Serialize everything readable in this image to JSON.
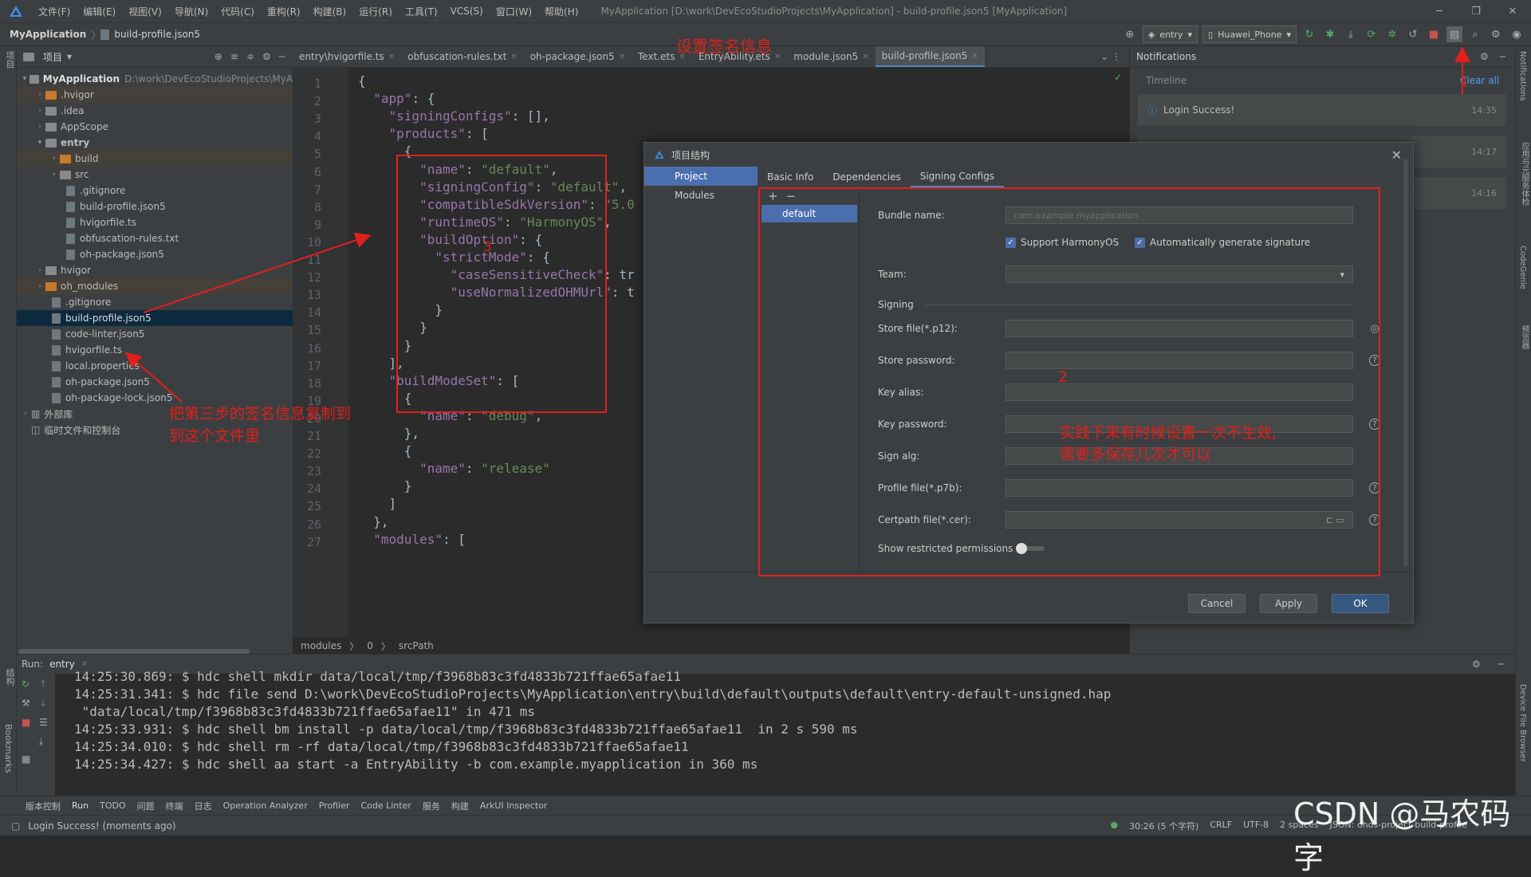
{
  "menubar": {
    "items": [
      "文件(F)",
      "编辑(E)",
      "视图(V)",
      "导航(N)",
      "代码(C)",
      "重构(R)",
      "构建(B)",
      "运行(R)",
      "工具(T)",
      "VCS(S)",
      "窗口(W)",
      "帮助(H)"
    ],
    "window_title": "MyApplication [D:\\work\\DevEcoStudioProjects\\MyApplication] - build-profile.json5 [MyApplication]"
  },
  "navbar": {
    "crumbs": [
      "MyApplication",
      "build-profile.json5"
    ],
    "run_config": "entry",
    "device": "Huawei_Phone"
  },
  "left_stripe": {
    "project_label": "项目",
    "bookmarks_label": "Bookmarks",
    "structure_label": "结构"
  },
  "project": {
    "title": "项目",
    "rows": [
      {
        "name": "MyApplication",
        "path": "D:\\work\\DevEcoStudioProjects\\MyA"
      },
      {
        "name": ".hvigor"
      },
      {
        "name": ".idea"
      },
      {
        "name": "AppScope"
      },
      {
        "name": "entry"
      },
      {
        "name": "build"
      },
      {
        "name": "src"
      },
      {
        "name": ".gitignore"
      },
      {
        "name": "build-profile.json5"
      },
      {
        "name": "hvigorfile.ts"
      },
      {
        "name": "obfuscation-rules.txt"
      },
      {
        "name": "oh-package.json5"
      },
      {
        "name": "hvigor"
      },
      {
        "name": "oh_modules"
      },
      {
        "name": ".gitignore"
      },
      {
        "name": "build-profile.json5"
      },
      {
        "name": "code-linter.json5"
      },
      {
        "name": "hvigorfile.ts"
      },
      {
        "name": "local.properties"
      },
      {
        "name": "oh-package.json5"
      },
      {
        "name": "oh-package-lock.json5"
      },
      {
        "name": "外部库"
      },
      {
        "name": "临时文件和控制台"
      }
    ]
  },
  "editor": {
    "tabs": [
      "entry\\hvigorfile.ts",
      "obfuscation-rules.txt",
      "oh-package.json5",
      "Text.ets",
      "EntryAbility.ets",
      "module.json5",
      "build-profile.json5"
    ],
    "line_numbers": [
      "1",
      "2",
      "3",
      "4",
      "5",
      "6",
      "7",
      "8",
      "9",
      "10",
      "11",
      "12",
      "13",
      "14",
      "15",
      "16",
      "17",
      "18",
      "19",
      "20",
      "21",
      "22",
      "23",
      "24",
      "25",
      "26",
      "27"
    ],
    "lines": [
      {
        "i": "",
        "k": "",
        "v": "{"
      },
      {
        "i": "  ",
        "k": "\"app\"",
        "v": ": {"
      },
      {
        "i": "    ",
        "k": "\"signingConfigs\"",
        "v": ": [],"
      },
      {
        "i": "    ",
        "k": "\"products\"",
        "v": ": ["
      },
      {
        "i": "      ",
        "k": "",
        "v": "{"
      },
      {
        "i": "        ",
        "k": "\"name\"",
        "v": ": ",
        "s": "\"default\"",
        "t": ","
      },
      {
        "i": "        ",
        "k": "\"signingConfig\"",
        "v": ": ",
        "s": "\"default\"",
        "t": ","
      },
      {
        "i": "        ",
        "k": "\"compatibleSdkVersion\"",
        "v": ": ",
        "s": "\"5.0",
        "t": ""
      },
      {
        "i": "        ",
        "k": "\"runtimeOS\"",
        "v": ": ",
        "s": "\"HarmonyOS\"",
        "t": ","
      },
      {
        "i": "        ",
        "k": "\"buildOption\"",
        "v": ": {"
      },
      {
        "i": "          ",
        "k": "\"strictMode\"",
        "v": ": {"
      },
      {
        "i": "            ",
        "k": "\"caseSensitiveCheck\"",
        "v": ": tr"
      },
      {
        "i": "            ",
        "k": "\"useNormalizedOHMUrl\"",
        "v": ": t"
      },
      {
        "i": "          ",
        "k": "",
        "v": "}"
      },
      {
        "i": "        ",
        "k": "",
        "v": "}"
      },
      {
        "i": "      ",
        "k": "",
        "v": "}"
      },
      {
        "i": "    ",
        "k": "",
        "v": "],"
      },
      {
        "i": "    ",
        "k": "\"buildModeSet\"",
        "v": ": ["
      },
      {
        "i": "      ",
        "k": "",
        "v": "{"
      },
      {
        "i": "        ",
        "k": "\"name\"",
        "v": ": ",
        "s": "\"debug\"",
        "t": ","
      },
      {
        "i": "      ",
        "k": "",
        "v": "},"
      },
      {
        "i": "      ",
        "k": "",
        "v": "{"
      },
      {
        "i": "        ",
        "k": "\"name\"",
        "v": ": ",
        "s": "\"release\"",
        "t": ""
      },
      {
        "i": "      ",
        "k": "",
        "v": "}"
      },
      {
        "i": "    ",
        "k": "",
        "v": "]"
      },
      {
        "i": "  ",
        "k": "",
        "v": "},"
      },
      {
        "i": "  ",
        "k": "\"modules\"",
        "v": ": ["
      }
    ],
    "breadcrumbs": [
      "modules",
      "0",
      "srcPath"
    ]
  },
  "notifications": {
    "title": "Notifications",
    "timeline": "Timeline",
    "clear_all": "Clear all",
    "items": [
      {
        "text": "Login Success!",
        "time": "14:35"
      },
      {
        "text": "",
        "time": "14:17"
      },
      {
        "text": "",
        "time": "14:16"
      }
    ]
  },
  "right_stripe": [
    "Notifications",
    "应用与元服务体检",
    "CodeGenie",
    "预览器",
    "Device File Browser"
  ],
  "dialog": {
    "title": "项目结构",
    "nav": [
      "Project",
      "Modules"
    ],
    "tabs": [
      "Basic Info",
      "Dependencies",
      "Signing Configs"
    ],
    "list_add": "+",
    "list_remove": "−",
    "config_name": "default",
    "bundle_label": "Bundle name:",
    "bundle_value": "com.example.myapplication",
    "support_harmony": "Support HarmonyOS",
    "auto_sign": "Automatically generate signature",
    "team_label": "Team:",
    "signing_section": "Signing",
    "store_file": "Store file(*.p12):",
    "store_password": "Store password:",
    "key_alias": "Key alias:",
    "key_password": "Key password:",
    "sign_alg": "Sign alg:",
    "profile_file": "Profile file(*.p7b):",
    "certpath_file": "Certpath file(*.cer):",
    "show_restricted": "Show restricted permissions",
    "cancel": "Cancel",
    "apply": "Apply",
    "ok": "OK"
  },
  "annotations": {
    "title_note": "设置签名信息",
    "copy_note_1": "把第三步的签名信息复制到",
    "copy_note_2": "到这个文件里",
    "num3": "3",
    "num2": "2",
    "tip_1": "实践下来有时候设置一次不生效,",
    "tip_2": "需要多保存几次才可以",
    "marker": "1"
  },
  "run": {
    "label": "Run:",
    "config": "entry",
    "lines": [
      "14:25:30.869: $ hdc shell mkdir data/local/tmp/f3968b83c3fd4833b721ffae65afae11",
      "14:25:31.341: $ hdc file send D:\\work\\DevEcoStudioProjects\\MyApplication\\entry\\build\\default\\outputs\\default\\entry-default-unsigned.hap",
      " \"data/local/tmp/f3968b83c3fd4833b721ffae65afae11\" in 471 ms",
      "14:25:33.931: $ hdc shell bm install -p data/local/tmp/f3968b83c3fd4833b721ffae65afae11  in 2 s 590 ms",
      "14:25:34.010: $ hdc shell rm -rf data/local/tmp/f3968b83c3fd4833b721ffae65afae11",
      "14:25:34.427: $ hdc shell aa start -a EntryAbility -b com.example.myapplication in 360 ms"
    ]
  },
  "toolstrip": [
    "版本控制",
    "Run",
    "TODO",
    "问题",
    "终端",
    "日志",
    "Operation Analyzer",
    "Profiler",
    "Code Linter",
    "服务",
    "构建",
    "ArkUI Inspector"
  ],
  "status": {
    "message": "Login Success! (moments ago)",
    "position": "30:26 (5 个字符)",
    "line_sep": "CRLF",
    "encoding": "UTF-8",
    "indent": "2 spaces",
    "schema": "JSON: ohos-project-build-profile"
  },
  "watermark": "CSDN @马农码字"
}
